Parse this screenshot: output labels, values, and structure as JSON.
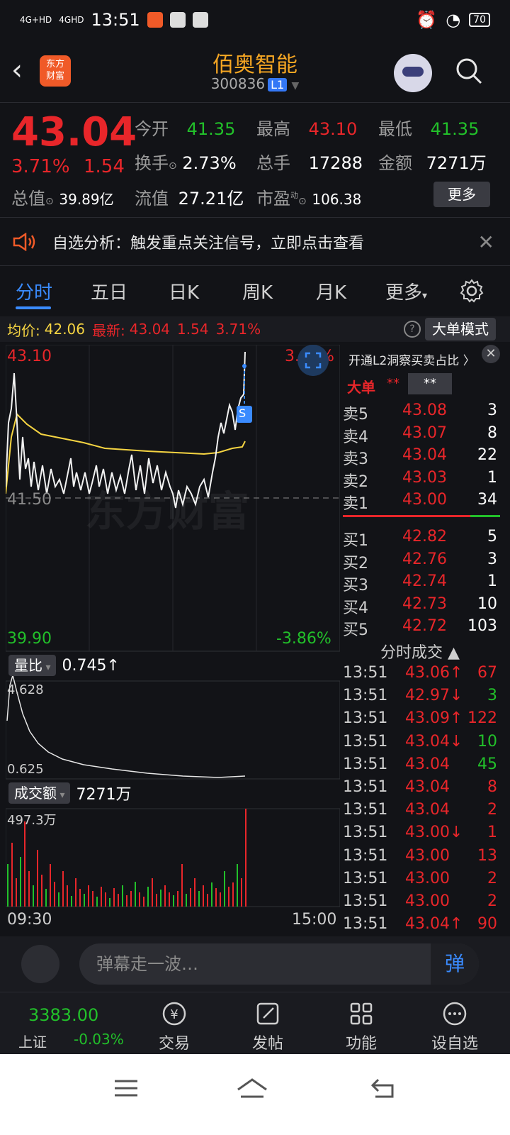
{
  "status": {
    "time": "13:51",
    "sig1": "4G+HD",
    "sig2": "4GHD",
    "battery": "70"
  },
  "header": {
    "logo_line1": "东方",
    "logo_line2": "财富",
    "stock_name": "佰奥智能",
    "stock_code": "300836",
    "level": "L1"
  },
  "quote": {
    "price": "43.04",
    "change_pct": "3.71%",
    "change": "1.54",
    "open_label": "今开",
    "open": "41.35",
    "high_label": "最高",
    "high": "43.10",
    "low_label": "最低",
    "low": "41.35",
    "turnover_label": "换手",
    "turnover": "2.73%",
    "volume_label": "总手",
    "volume": "17288",
    "amount_label": "金额",
    "amount": "7271万",
    "mktcap_label": "总值",
    "mktcap": "39.89亿",
    "float_label": "流值",
    "float_cap": "27.21亿",
    "pe_label": "市盈",
    "pe_sup": "动",
    "pe": "106.38",
    "more": "更多"
  },
  "notice": {
    "text": "自选分析：触发重点关注信号，立即点击查看"
  },
  "tabs": [
    "分时",
    "五日",
    "日K",
    "周K",
    "月K",
    "更多"
  ],
  "avgbar": {
    "avg_label": "均价:",
    "avg": "42.06",
    "latest_label": "最新:",
    "latest": "43.04",
    "chg": "1.54",
    "pct": "3.71%",
    "mode_btn": "大单模式"
  },
  "chart_labels": {
    "top_left": "43.10",
    "top_right": "3.86%",
    "mid_left": "41.50",
    "bottom_left": "39.90",
    "bottom_right": "-3.86%",
    "vr_pill": "量比",
    "vr_val": "0.745↑",
    "vr_top": "4.628",
    "vr_bottom": "0.625",
    "amt_pill": "成交额",
    "amt_val": "7271万",
    "amt_top": "497.3万",
    "t_start": "09:30",
    "t_end": "15:00",
    "marker": "S",
    "watermark": "东方财富"
  },
  "orderbook": {
    "head": "开通L2洞察买卖占比 〉",
    "big": "大单",
    "stars1": "**",
    "stars2": "**",
    "asks": [
      {
        "label": "卖5",
        "price": "43.08",
        "vol": "3"
      },
      {
        "label": "卖4",
        "price": "43.07",
        "vol": "8"
      },
      {
        "label": "卖3",
        "price": "43.04",
        "vol": "22"
      },
      {
        "label": "卖2",
        "price": "43.03",
        "vol": "1"
      },
      {
        "label": "卖1",
        "price": "43.00",
        "vol": "34"
      }
    ],
    "bids": [
      {
        "label": "买1",
        "price": "42.82",
        "vol": "5"
      },
      {
        "label": "买2",
        "price": "42.76",
        "vol": "3"
      },
      {
        "label": "买3",
        "price": "42.74",
        "vol": "1"
      },
      {
        "label": "买4",
        "price": "42.73",
        "vol": "10"
      },
      {
        "label": "买5",
        "price": "42.72",
        "vol": "103"
      }
    ]
  },
  "trades_title": "分时成交 ▲",
  "trades": [
    {
      "t": "13:51",
      "p": "43.06↑",
      "v": "67",
      "c": "#e8262a"
    },
    {
      "t": "13:51",
      "p": "42.97↓",
      "v": "3",
      "c": "#22c02a"
    },
    {
      "t": "13:51",
      "p": "43.09↑",
      "v": "122",
      "c": "#e8262a"
    },
    {
      "t": "13:51",
      "p": "43.04↓",
      "v": "10",
      "c": "#22c02a"
    },
    {
      "t": "13:51",
      "p": "43.04",
      "v": "45",
      "c": "#22c02a"
    },
    {
      "t": "13:51",
      "p": "43.04",
      "v": "8",
      "c": "#e8262a"
    },
    {
      "t": "13:51",
      "p": "43.04",
      "v": "2",
      "c": "#e8262a"
    },
    {
      "t": "13:51",
      "p": "43.00↓",
      "v": "1",
      "c": "#e8262a"
    },
    {
      "t": "13:51",
      "p": "43.00",
      "v": "13",
      "c": "#e8262a"
    },
    {
      "t": "13:51",
      "p": "43.00",
      "v": "2",
      "c": "#e8262a"
    },
    {
      "t": "13:51",
      "p": "43.00",
      "v": "2",
      "c": "#e8262a"
    },
    {
      "t": "13:51",
      "p": "43.04↑",
      "v": "90",
      "c": "#e8262a"
    }
  ],
  "danmaku": {
    "placeholder": "弹幕走一波…",
    "send": "弹"
  },
  "bottom": {
    "idx_val": "3383.00",
    "idx_name": "上证",
    "idx_chg": "-0.03%",
    "trade": "交易",
    "post": "发帖",
    "func": "功能",
    "watch": "设自选"
  }
}
